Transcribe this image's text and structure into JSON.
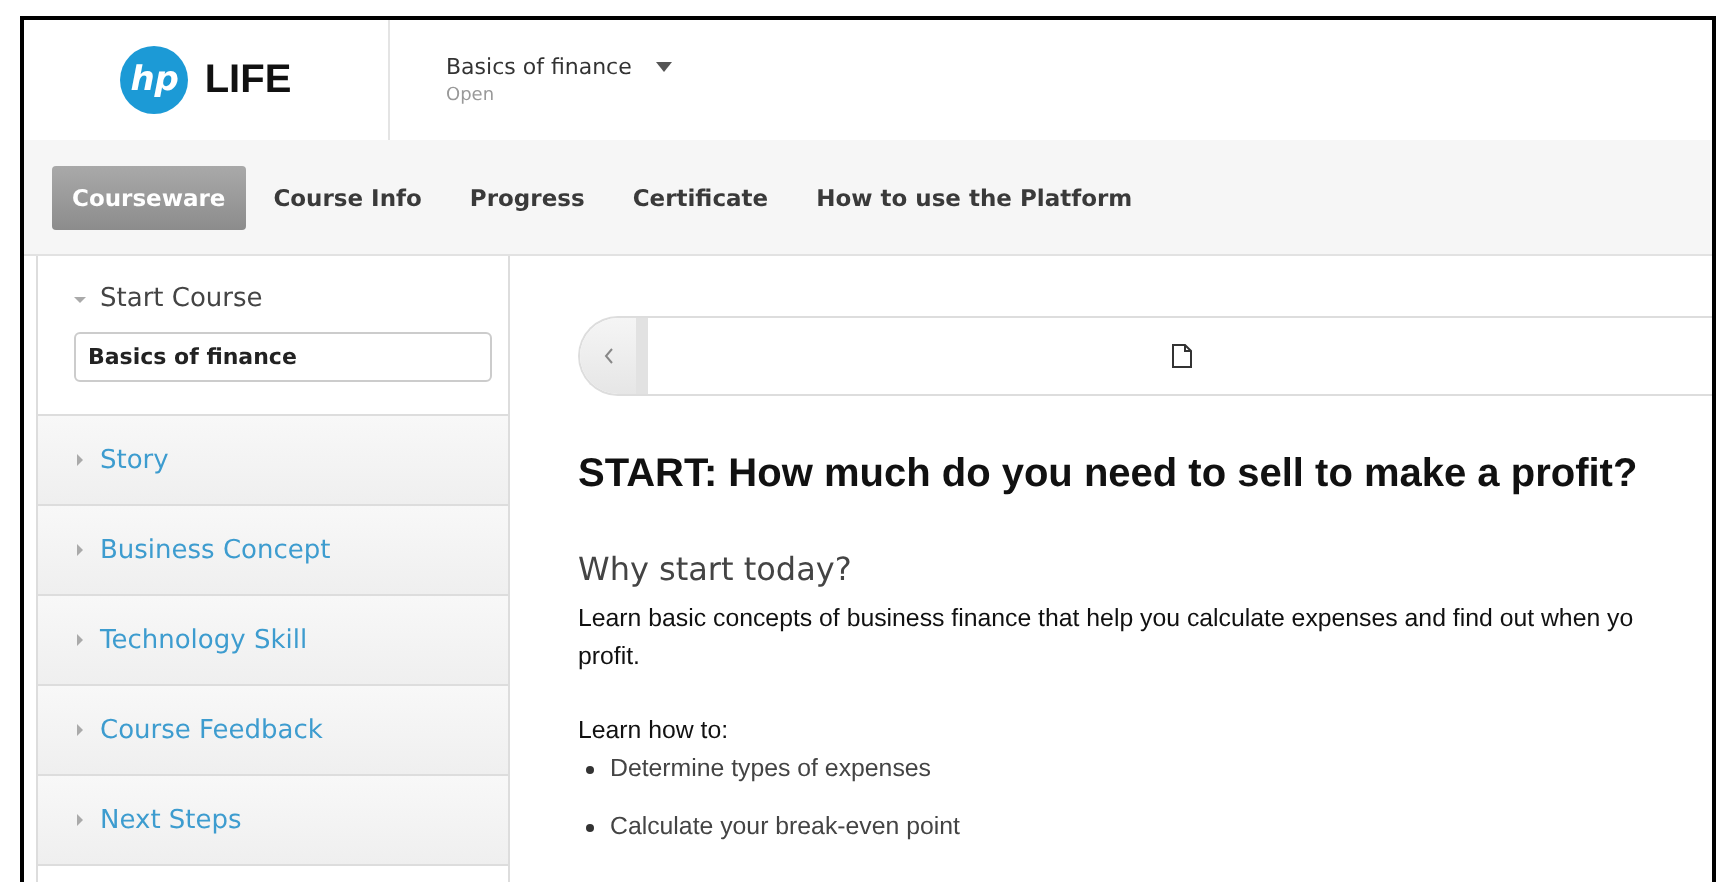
{
  "logo": {
    "mark": "hp",
    "name": "LIFE"
  },
  "course": {
    "title": "Basics of finance",
    "status": "Open"
  },
  "tabs": [
    {
      "label": "Courseware",
      "selected": true
    },
    {
      "label": "Course Info",
      "selected": false
    },
    {
      "label": "Progress",
      "selected": false
    },
    {
      "label": "Certificate",
      "selected": false
    },
    {
      "label": "How to use the Platform",
      "selected": false
    }
  ],
  "sidebar": {
    "sections": [
      {
        "title": "Start Course",
        "expanded": true,
        "children": [
          {
            "label": "Basics of finance",
            "selected": true
          }
        ]
      },
      {
        "title": "Story",
        "expanded": false
      },
      {
        "title": "Business Concept",
        "expanded": false
      },
      {
        "title": "Technology Skill",
        "expanded": false
      },
      {
        "title": "Course Feedback",
        "expanded": false
      },
      {
        "title": "Next Steps",
        "expanded": false
      }
    ]
  },
  "content": {
    "heading": "START: How much do you need to sell to make a profit?",
    "subheading": "Why start today?",
    "intro_lines": [
      "Learn basic concepts of business finance that help you calculate expenses and find out when yo",
      "profit."
    ],
    "list_title": "Learn how to:",
    "bullets": [
      "Determine types of expenses",
      "Calculate your break-even point"
    ]
  }
}
